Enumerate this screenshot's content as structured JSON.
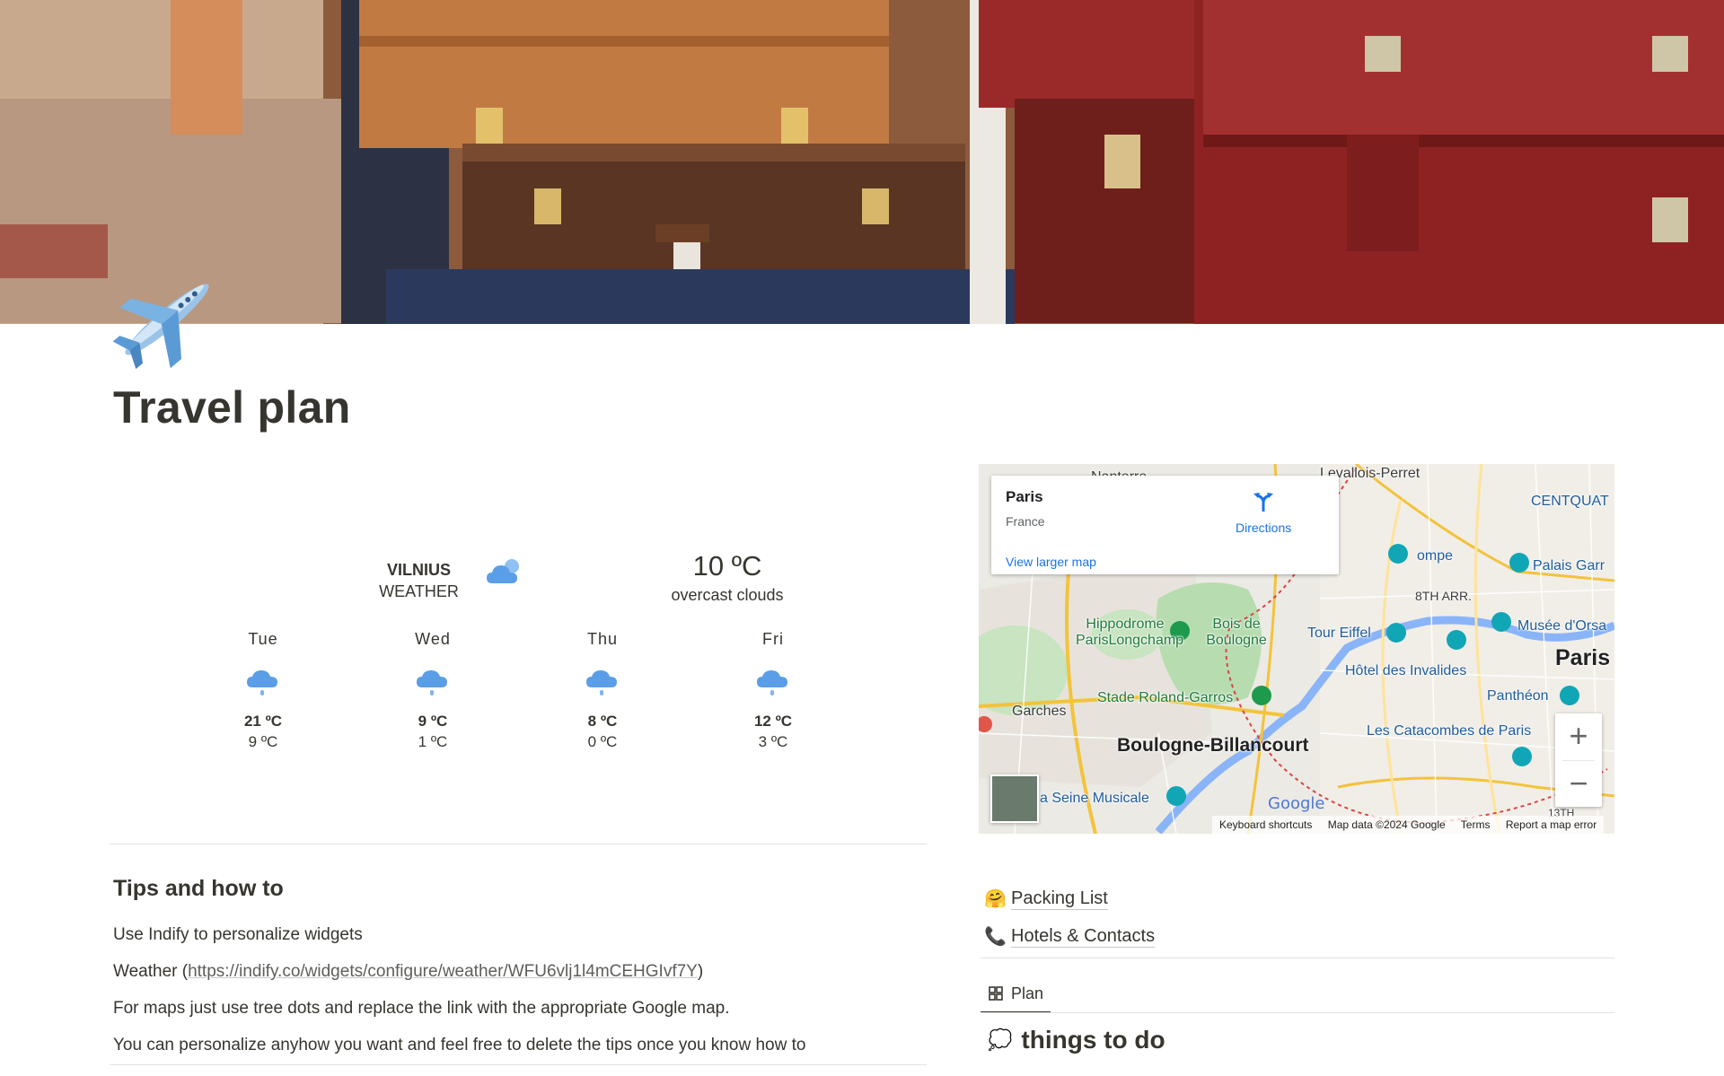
{
  "page": {
    "title": "Travel plan"
  },
  "weather": {
    "city": "VILNIUS",
    "label": "WEATHER",
    "current_temp": "10 ºC",
    "current_desc": "overcast clouds",
    "forecast": [
      {
        "day": "Tue",
        "high": "21 ºC",
        "low": "9 ºC",
        "icon": "rain-cloud-icon"
      },
      {
        "day": "Wed",
        "high": "9 ºC",
        "low": "1 ºC",
        "icon": "rain-cloud-icon"
      },
      {
        "day": "Thu",
        "high": "8 ºC",
        "low": "0 ºC",
        "icon": "rain-cloud-icon"
      },
      {
        "day": "Fri",
        "high": "12 ºC",
        "low": "3 ºC",
        "icon": "rain-cloud-icon"
      }
    ]
  },
  "map": {
    "place": "Paris",
    "country": "France",
    "directions": "Directions",
    "view_larger": "View larger map",
    "zoom_in": "+",
    "zoom_out": "−",
    "google": "Google",
    "attribution": [
      "Keyboard shortcuts",
      "Map data ©2024 Google",
      "Terms",
      "Report a map error"
    ],
    "labels": {
      "levallois": "Levallois-Perret",
      "centquat": "CENTQUAT",
      "palais": "Palais Garr",
      "arr8": "8TH ARR.",
      "musee": "Musée d'Orsa",
      "paris": "Paris",
      "hippodrome": "Hippodrome ParisLongchamp",
      "bois": "Bois de Boulogne",
      "eiffel": "Tour Eiffel",
      "invalides": "Hôtel des Invalides",
      "pantheon": "Panthéon",
      "rolandgarros": "Stade Roland-Garros",
      "garches": "Garches",
      "boulogne": "Boulogne-Billancourt",
      "catacombes": "Les Catacombes de Paris",
      "seine": "a Seine Musicale",
      "nanterre": "Nanterre",
      "ompe": "ompe",
      "arr13": "13TH"
    }
  },
  "tips": {
    "heading": "Tips and how to",
    "line1": "Use Indify to personalize widgets",
    "line2_prefix": "Weather (",
    "line2_link": "https://indify.co/widgets/configure/weather/WFU6vlj1l4mCEHGIvf7Y",
    "line2_suffix": ")",
    "line3": "For maps just use tree dots and replace the link with the appropriate Google map.",
    "line4": "You can personalize anyhow you want and feel free to delete the tips once you know how to"
  },
  "links": [
    {
      "emoji": "🤗",
      "label": "Packing List"
    },
    {
      "emoji": "📞",
      "label": "Hotels & Contacts"
    }
  ],
  "view_tab": {
    "label": "Plan"
  },
  "section": {
    "emoji": "💭",
    "title": "things to do"
  },
  "colors": {
    "map_blue": "#1a73e8",
    "text": "#37352f",
    "weather_icon": "#5a9ee8"
  }
}
